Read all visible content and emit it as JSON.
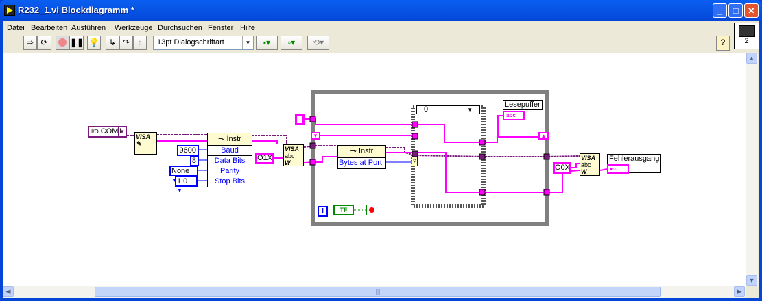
{
  "window": {
    "title": "R232_1.vi Blockdiagramm *",
    "minimize": "_",
    "maximize": "□",
    "close": "✕"
  },
  "menu": [
    "Datei",
    "Bearbeiten",
    "Ausführen",
    "Werkzeuge",
    "Durchsuchen",
    "Fenster",
    "Hilfe"
  ],
  "toolbar": {
    "font_select": "13pt Dialogschriftart",
    "help": "?",
    "connector_pane_number": "2",
    "buttons": [
      "run-icon",
      "run-continuously-icon",
      "abort-icon",
      "pause-icon",
      "highlight-execution-icon",
      "step-into-icon",
      "step-over-icon",
      "step-out-icon",
      "align-icon",
      "distribute-icon",
      "reorder-icon"
    ]
  },
  "diagram": {
    "com_port": "COM1",
    "visa_open_label": "VISA",
    "property_node_1": {
      "header": "Instr",
      "rows": [
        "Baud",
        "Data Bits",
        "Parity",
        "Stop Bits"
      ]
    },
    "constants": {
      "baud": "9600",
      "data_bits": "8",
      "parity": "None",
      "stop_bits": "1.0"
    },
    "write_string_1": "O1X",
    "visa_write_label": "VISA",
    "visa_write_sub": "abc",
    "property_node_2": {
      "header": "Instr",
      "rows": [
        "Bytes at Port"
      ]
    },
    "case_selector": "0",
    "loop_iteration": "i",
    "stop_constant": "TF",
    "read_buffer_label": "Lesepuffer",
    "read_buffer_indicator": "abc",
    "write_string_2": "O0X",
    "error_out_label": "Fehlerausgang 2",
    "case_tunnel": "?"
  },
  "colors": {
    "string_wire": "#ff00ff",
    "visa_wire": "#7a1a7a",
    "numeric": "#0000ff",
    "loop_border": "#808080"
  }
}
